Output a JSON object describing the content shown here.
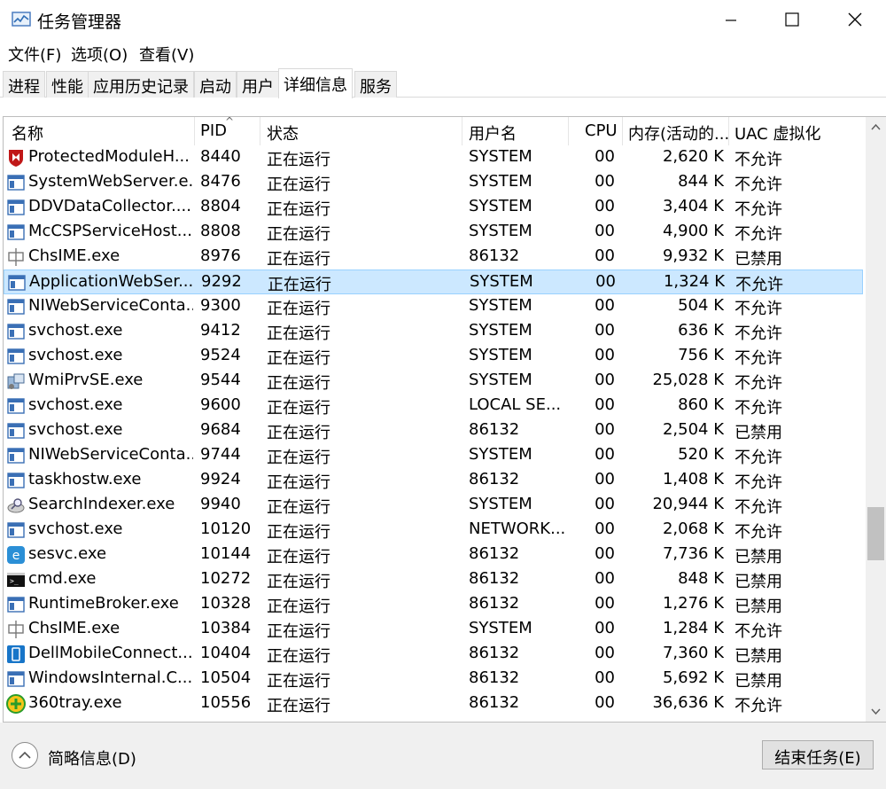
{
  "window": {
    "title": "任务管理器",
    "icon": "task-manager-icon"
  },
  "menu": [
    "文件(F)",
    "选项(O)",
    "查看(V)"
  ],
  "tabs": [
    "进程",
    "性能",
    "应用历史记录",
    "启动",
    "用户",
    "详细信息",
    "服务"
  ],
  "active_tab": "详细信息",
  "columns": {
    "name": "名称",
    "pid": "PID",
    "status": "状态",
    "user": "用户名",
    "cpu": "CPU",
    "memory": "内存(活动的...",
    "uac": "UAC 虚拟化"
  },
  "sort_column": "pid",
  "rows": [
    {
      "icon": "mcafee-shield-icon",
      "name": "ProtectedModuleH...",
      "pid": "8440",
      "status": "正在运行",
      "user": "SYSTEM",
      "cpu": "00",
      "memory": "2,620 K",
      "uac": "不允许"
    },
    {
      "icon": "app-window-icon",
      "name": "SystemWebServer.e...",
      "pid": "8476",
      "status": "正在运行",
      "user": "SYSTEM",
      "cpu": "00",
      "memory": "844 K",
      "uac": "不允许"
    },
    {
      "icon": "app-window-icon",
      "name": "DDVDataCollector....",
      "pid": "8804",
      "status": "正在运行",
      "user": "SYSTEM",
      "cpu": "00",
      "memory": "3,404 K",
      "uac": "不允许"
    },
    {
      "icon": "app-window-icon",
      "name": "McCSPServiceHost....",
      "pid": "8808",
      "status": "正在运行",
      "user": "SYSTEM",
      "cpu": "00",
      "memory": "4,900 K",
      "uac": "不允许"
    },
    {
      "icon": "ime-icon",
      "name": "ChsIME.exe",
      "pid": "8976",
      "status": "正在运行",
      "user": "86132",
      "cpu": "00",
      "memory": "9,932 K",
      "uac": "已禁用"
    },
    {
      "icon": "app-window-icon",
      "name": "ApplicationWebSer...",
      "pid": "9292",
      "status": "正在运行",
      "user": "SYSTEM",
      "cpu": "00",
      "memory": "1,324 K",
      "uac": "不允许",
      "selected": true
    },
    {
      "icon": "app-window-icon",
      "name": "NIWebServiceConta...",
      "pid": "9300",
      "status": "正在运行",
      "user": "SYSTEM",
      "cpu": "00",
      "memory": "504 K",
      "uac": "不允许"
    },
    {
      "icon": "app-window-icon",
      "name": "svchost.exe",
      "pid": "9412",
      "status": "正在运行",
      "user": "SYSTEM",
      "cpu": "00",
      "memory": "636 K",
      "uac": "不允许"
    },
    {
      "icon": "app-window-icon",
      "name": "svchost.exe",
      "pid": "9524",
      "status": "正在运行",
      "user": "SYSTEM",
      "cpu": "00",
      "memory": "756 K",
      "uac": "不允许"
    },
    {
      "icon": "wmi-icon",
      "name": "WmiPrvSE.exe",
      "pid": "9544",
      "status": "正在运行",
      "user": "SYSTEM",
      "cpu": "00",
      "memory": "25,028 K",
      "uac": "不允许"
    },
    {
      "icon": "app-window-icon",
      "name": "svchost.exe",
      "pid": "9600",
      "status": "正在运行",
      "user": "LOCAL SE...",
      "cpu": "00",
      "memory": "860 K",
      "uac": "不允许"
    },
    {
      "icon": "app-window-icon",
      "name": "svchost.exe",
      "pid": "9684",
      "status": "正在运行",
      "user": "86132",
      "cpu": "00",
      "memory": "2,504 K",
      "uac": "已禁用"
    },
    {
      "icon": "app-window-icon",
      "name": "NIWebServiceConta...",
      "pid": "9744",
      "status": "正在运行",
      "user": "SYSTEM",
      "cpu": "00",
      "memory": "520 K",
      "uac": "不允许"
    },
    {
      "icon": "app-window-icon",
      "name": "taskhostw.exe",
      "pid": "9924",
      "status": "正在运行",
      "user": "86132",
      "cpu": "00",
      "memory": "1,408 K",
      "uac": "不允许"
    },
    {
      "icon": "search-indexer-icon",
      "name": "SearchIndexer.exe",
      "pid": "9940",
      "status": "正在运行",
      "user": "SYSTEM",
      "cpu": "00",
      "memory": "20,944 K",
      "uac": "不允许"
    },
    {
      "icon": "app-window-icon",
      "name": "svchost.exe",
      "pid": "10120",
      "status": "正在运行",
      "user": "NETWORK...",
      "cpu": "00",
      "memory": "2,068 K",
      "uac": "不允许"
    },
    {
      "icon": "sesvc-icon",
      "name": "sesvc.exe",
      "pid": "10144",
      "status": "正在运行",
      "user": "86132",
      "cpu": "00",
      "memory": "7,736 K",
      "uac": "已禁用"
    },
    {
      "icon": "cmd-icon",
      "name": "cmd.exe",
      "pid": "10272",
      "status": "正在运行",
      "user": "86132",
      "cpu": "00",
      "memory": "848 K",
      "uac": "已禁用"
    },
    {
      "icon": "app-window-icon",
      "name": "RuntimeBroker.exe",
      "pid": "10328",
      "status": "正在运行",
      "user": "86132",
      "cpu": "00",
      "memory": "1,276 K",
      "uac": "已禁用"
    },
    {
      "icon": "ime-icon",
      "name": "ChsIME.exe",
      "pid": "10384",
      "status": "正在运行",
      "user": "SYSTEM",
      "cpu": "00",
      "memory": "1,284 K",
      "uac": "不允许"
    },
    {
      "icon": "dell-mobile-connect-icon",
      "name": "DellMobileConnect...",
      "pid": "10404",
      "status": "正在运行",
      "user": "86132",
      "cpu": "00",
      "memory": "7,360 K",
      "uac": "已禁用"
    },
    {
      "icon": "app-window-icon",
      "name": "WindowsInternal.C...",
      "pid": "10504",
      "status": "正在运行",
      "user": "86132",
      "cpu": "00",
      "memory": "5,692 K",
      "uac": "已禁用"
    },
    {
      "icon": "tray-360-icon",
      "name": "360tray.exe",
      "pid": "10556",
      "status": "正在运行",
      "user": "86132",
      "cpu": "00",
      "memory": "36,636 K",
      "uac": "不允许"
    }
  ],
  "footer": {
    "brief_label": "简略信息(D)",
    "end_task_label": "结束任务(E)"
  },
  "colors": {
    "selected_bg": "#cce8ff",
    "selected_border": "#99d1ff"
  }
}
